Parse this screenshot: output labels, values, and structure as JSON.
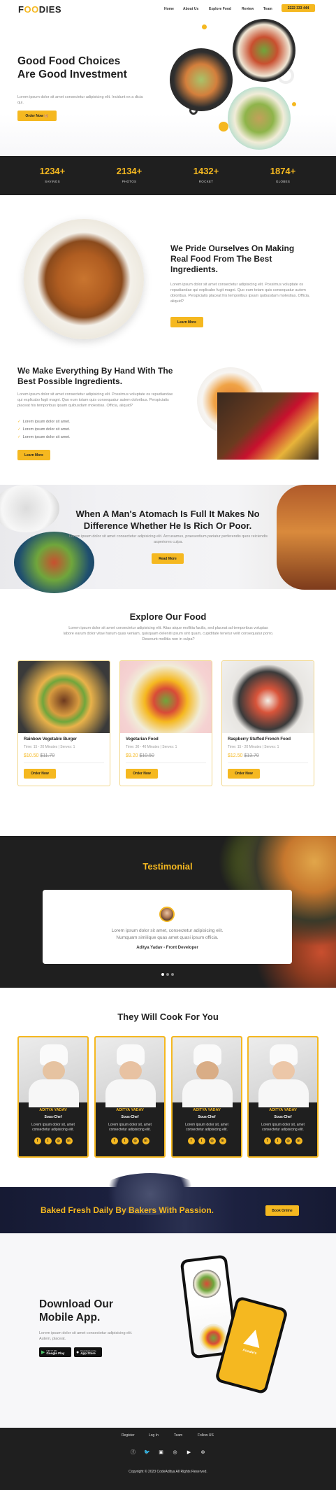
{
  "header": {
    "logo_left": "F",
    "logo_oo": "OO",
    "logo_right": "DIES",
    "nav": [
      "Home",
      "About Us",
      "Explore Food",
      "Review",
      "Team"
    ],
    "phone": "2222 333 444"
  },
  "hero": {
    "title_line1": "Good Food Choices",
    "title_line2": "Are Good Investment",
    "text": "Lorem ipsum dolor sit amet consectetur adipisicing elit. Incidunt ex a dicta qui.",
    "button": "Order Now"
  },
  "stats": [
    {
      "value": "1234+",
      "label": "SAVINGS"
    },
    {
      "value": "2134+",
      "label": "PHOTOS"
    },
    {
      "value": "1432+",
      "label": "ROCKET"
    },
    {
      "value": "1874+",
      "label": "GLOBES"
    }
  ],
  "about1": {
    "title": "We Pride Ourselves On Making Real Food From The Best Ingredients.",
    "text": "Lorem ipsum dolor sit amet consectetur adipisicing elit. Possimus voluptate os repudiandae qui explicabo fugit magni. Quo eum totam quis consequatur autem doloribus. Perspiciatis placeat his temporibus ipsam quibusdam molestias. Officia, aliquid?",
    "button": "Learn More"
  },
  "about2": {
    "title": "We Make Everything By Hand With The Best Possible Ingredients.",
    "text": "Lorem ipsum dolor sit amet consectetur adipisicing elit. Possimus voluptate os repudiandae qui explicabo fugit magni. Quo eum totam quis consequatur autem doloribus. Perspiciatis placeat his temporibus ipsam quibusdam molestias. Officia, aliquid?",
    "list": [
      "Lorem ipsum dolor sit amet.",
      "Lorem ipsum dolor sit amet.",
      "Lorem ipsum dolor sit amet."
    ],
    "button": "Learn More"
  },
  "banner": {
    "title_line1": "When A Man's Atomach Is Full It Makes No",
    "title_line2": "Difference Whether He Is Rich Or Poor.",
    "text": "Lorem ipsum dolor sit amet consectetur adipisicing elit. Accusamus, praesentium pariatur perferendis quos reiciendis asperiores culpa.",
    "button": "Read More"
  },
  "explore": {
    "title": "Explore Our Food",
    "text": "Lorem ipsum dolor sit amet consectetur adipisicing elit. Alias atque mollitia facilis, sed placeat ad temporibus voluptas labore earum dolor vitae harum quas veniam, quisquam deleniti ipsum sint quam, cupiditate tenetur velit consequatur porro. Deserunt mollitia non in culpa?",
    "items": [
      {
        "name": "Rainbow Vegetable Burger",
        "meta": "Time: 15 - 20 Minutes | Serves: 1",
        "price": "$10.50",
        "old_price": "$11.70",
        "button": "Order Now"
      },
      {
        "name": "Vegetarian Food",
        "meta": "Time: 30 - 40 Minutes | Serves: 1",
        "price": "$9.20",
        "old_price": "$10.50",
        "button": "Order Now"
      },
      {
        "name": "Raspberry Stuffed French Food",
        "meta": "Time: 15 - 20 Minutes | Serves: 1",
        "price": "$12.50",
        "old_price": "$13.70",
        "button": "Order Now"
      }
    ]
  },
  "testimonial": {
    "title": "Testimonial",
    "quote_line1": "Lorem ipsum dolor sit amet, consectetur adipisicing elit.",
    "quote_line2": "Numquam similique quas amet quasi ipsum officia.",
    "author": "Aditya Yadav - Front Developer"
  },
  "team": {
    "title": "They Will Cook For You",
    "chefs": [
      {
        "name": "ADITYA YADAV",
        "role": "Sous-Chef",
        "text": "Lorem ipsum dolor sit, amet consectetur adipisicing elit."
      },
      {
        "name": "ADITYA YADAV",
        "role": "Sous-Chef",
        "text": "Lorem ipsum dolor sit, amet consectetur adipisicing elit."
      },
      {
        "name": "ADITYA YADAV",
        "role": "Sous-Chef",
        "text": "Lorem ipsum dolor sit, amet consectetur adipisicing elit."
      },
      {
        "name": "ADITYA YADAV",
        "role": "Sous-Chef",
        "text": "Lorem ipsum dolor sit, amet consectetur adipisicing elit."
      }
    ]
  },
  "bake": {
    "title": "Baked Fresh Daily By Bakers With Passion.",
    "button": "Book Online"
  },
  "app": {
    "title_line1": "Download Our",
    "title_line2": "Mobile App.",
    "text": "Lorem ipsum dolor sit amet consectetur adipisicing elit. Autem, placeat.",
    "google_small": "GET IT ON",
    "google": "Google Play",
    "apple_small": "Download on the",
    "apple": "App Store",
    "phone_text": "Foodie's"
  },
  "footer": {
    "links": [
      "Register",
      "Log In",
      "Team",
      "Follow US"
    ],
    "copyright": "Copyright © 2023 CodeAditya All Rights Reserved."
  },
  "colors": {
    "accent": "#f5b820",
    "dark": "#1f1f1f",
    "navy": "#1c2140"
  }
}
